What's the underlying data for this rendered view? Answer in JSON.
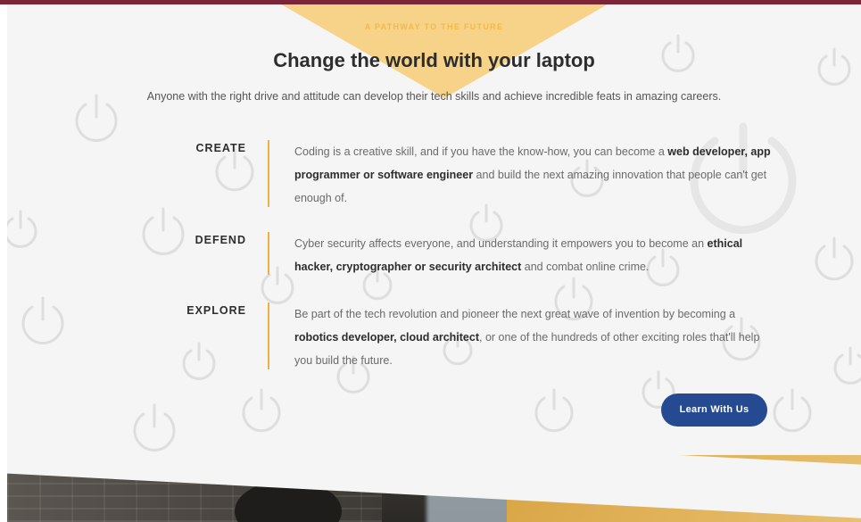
{
  "eyebrow": "A PATHWAY TO THE FUTURE",
  "title": "Change the world with your laptop",
  "subtitle": "Anyone with the right drive and attitude can develop their tech skills and achieve incredible feats in amazing careers.",
  "rows": [
    {
      "label": "CREATE",
      "text_before": "Coding is a creative skill, and if you have the know-how, you can become a ",
      "highlight": "web developer, app programmer or software engineer",
      "text_after": " and build the next amazing innovation that people can't get enough of."
    },
    {
      "label": "DEFEND",
      "text_before": "Cyber security affects everyone, and understanding it empowers you to become an ",
      "highlight": "ethical hacker, cryptographer or security architect",
      "text_after": " and combat online crime."
    },
    {
      "label": "EXPLORE",
      "text_before": "Be part of the tech revolution and pioneer the next great wave of invention by becoming a ",
      "highlight": "robotics developer, cloud architect",
      "text_after": ", or one of the hundreds of other exciting roles that'll help you build the future."
    }
  ],
  "cta_label": "Learn With Us",
  "icons": {
    "background": "power-icon"
  },
  "colors": {
    "accent": "#f0b042",
    "button": "#254a92",
    "top_bar": "#7c2438",
    "heading": "#2d2d2d"
  }
}
